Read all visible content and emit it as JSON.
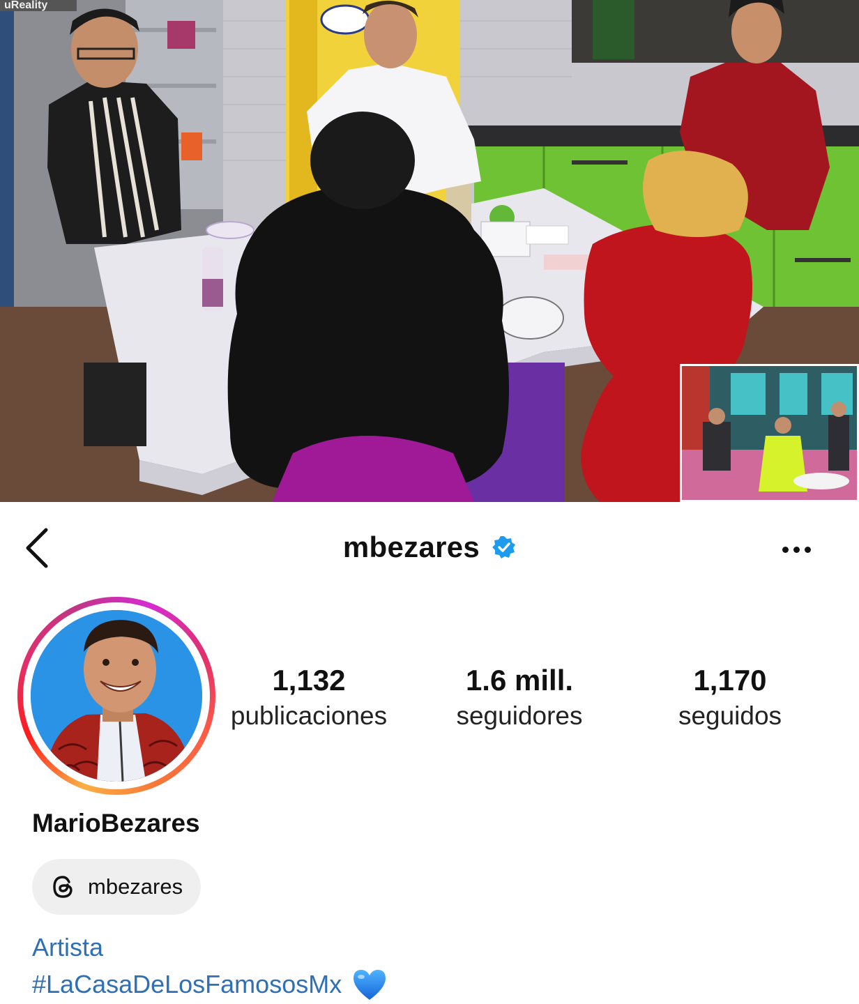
{
  "header": {
    "username": "mbezares",
    "verified": true
  },
  "profile": {
    "stats": {
      "posts_value": "1,132",
      "posts_label": "publicaciones",
      "followers_value": "1.6 mill.",
      "followers_label": "seguidores",
      "following_value": "1,170",
      "following_label": "seguidos"
    },
    "display_name": "MarioBezares",
    "threads_handle": "mbezares",
    "bio": {
      "category": "Artista",
      "hashtag": "#LaCasaDeLosFamososMx",
      "emoji": "blue-heart-icon"
    }
  },
  "colors": {
    "link": "#2f6fb4",
    "verified": "#1d9bf0",
    "chip_background": "#efefef"
  }
}
